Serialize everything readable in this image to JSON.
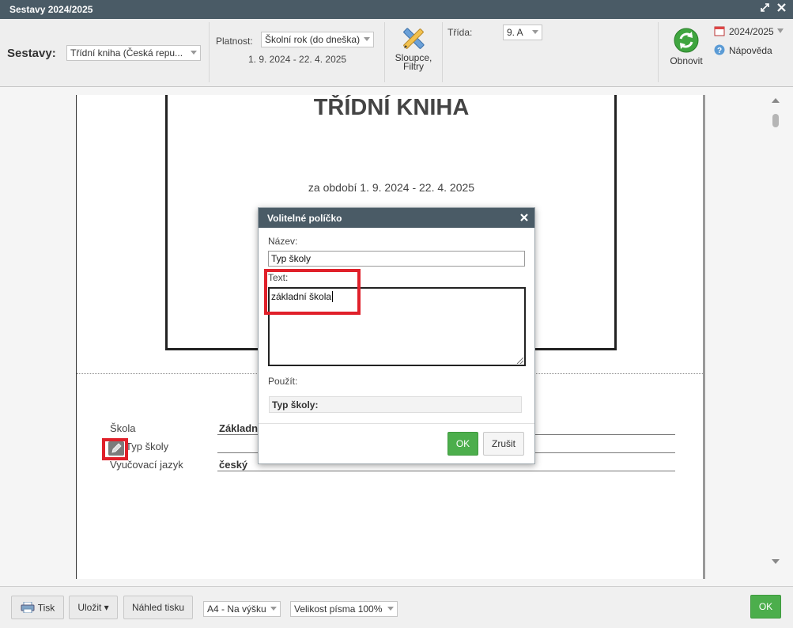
{
  "window": {
    "title": "Sestavy 2024/2025",
    "maximize_icon": "expand-arrows",
    "close_icon": "close-x"
  },
  "toolbar": {
    "sestavy_label": "Sestavy:",
    "report_select": "Třídní kniha (Česká repu...",
    "platnost_label": "Platnost:",
    "platnost_select": "Školní rok (do dneška)",
    "date_range": "1. 9. 2024 - 22. 4. 2025",
    "columns_button": "Sloupce, Filtry",
    "trida_label": "Třída:",
    "trida_select": "9. A",
    "refresh_button": "Obnovit",
    "year_link": "2024/2025",
    "help_link": "Nápověda"
  },
  "document": {
    "title": "TŘÍDNÍ KNIHA",
    "period": "za období 1. 9. 2024 - 22. 4. 2025",
    "rows": [
      {
        "label": "Škola",
        "value": "Základní"
      },
      {
        "label": "Typ školy",
        "value": ""
      },
      {
        "label": "Vyučovací jazyk",
        "value": "český"
      }
    ]
  },
  "dialog": {
    "title": "Volitelné políčko",
    "name_label": "Název:",
    "name_value": "Typ školy",
    "text_label": "Text:",
    "text_value": "základní škola",
    "use_label": "Použít:",
    "use_value": "Typ školy:",
    "ok_button": "OK",
    "cancel_button": "Zrušit"
  },
  "bottom": {
    "print_button": "Tisk",
    "save_button": "Uložit ▾",
    "preview_button": "Náhled tisku",
    "paper_select": "A4 - Na výšku",
    "font_select": "Velikost písma 100%",
    "ok_button": "OK"
  },
  "colors": {
    "header": "#4a5b66",
    "ok_green": "#4cae4c",
    "highlight_red": "#e0202a"
  }
}
